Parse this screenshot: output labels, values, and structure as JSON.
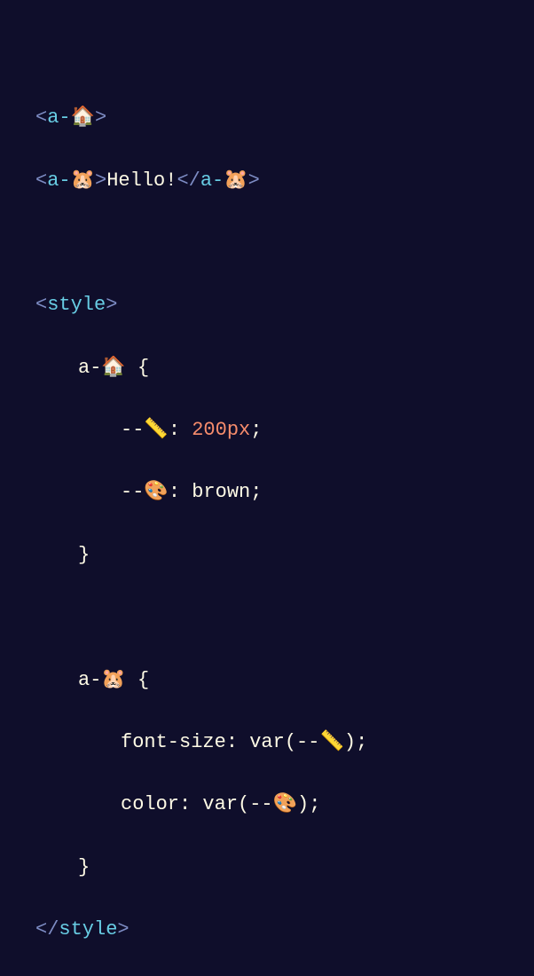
{
  "code": {
    "line1": {
      "open": "<",
      "tag": "a-",
      "emoji": "🏠",
      "close": ">"
    },
    "line2": {
      "open": "<",
      "tag": "a-",
      "emoji": "🐹",
      "mid": ">",
      "text": "Hello!",
      "cOpen": "</",
      "cTag": "a-",
      "cEmoji": "🐹",
      "cClose": ">"
    },
    "line3": "",
    "line4": {
      "open": "<",
      "tag": "style",
      "close": ">"
    },
    "line5": {
      "sel": "a-",
      "emoji": "🏠",
      "brace": " {"
    },
    "line6": {
      "dash": "--",
      "emoji": "📏",
      "colon": ": ",
      "val": "200px",
      "semi": ";"
    },
    "line7": {
      "dash": "--",
      "emoji": "🎨",
      "colon": ": ",
      "val": "brown",
      "semi": ";"
    },
    "line8": {
      "brace": "}"
    },
    "line9": "",
    "line10": {
      "sel": "a-",
      "emoji": "🐹",
      "brace": " {"
    },
    "line11": {
      "prop": "font-size",
      "colon": ": ",
      "fn": "var",
      "p1": "(",
      "dash": "--",
      "emoji": "📏",
      "p2": ")",
      "semi": ";"
    },
    "line12": {
      "prop": "color",
      "colon": ": ",
      "fn": "var",
      "p1": "(",
      "dash": "--",
      "emoji": "🎨",
      "p2": ")",
      "semi": ";"
    },
    "line13": {
      "brace": "}"
    },
    "line14": {
      "open": "</",
      "tag": "style",
      "close": ">"
    }
  }
}
